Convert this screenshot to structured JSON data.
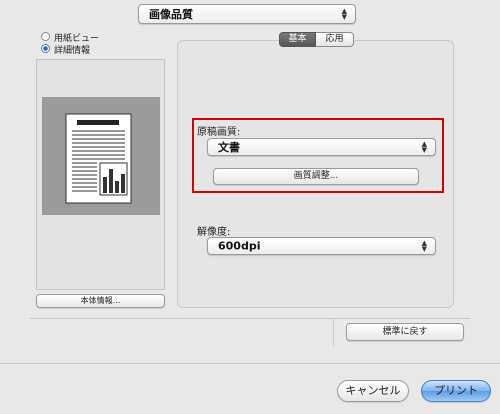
{
  "top_popup": {
    "label": "画像品質"
  },
  "view_options": {
    "paper_view": "用紙ビュー",
    "details": "詳細情報",
    "selected": "details"
  },
  "device_info_button": "本体情報...",
  "tabs": [
    {
      "label": "基本",
      "selected": true
    },
    {
      "label": "応用",
      "selected": false
    }
  ],
  "original_quality": {
    "label": "原稿画質:",
    "value": "文書",
    "adjust_button": "画質調整..."
  },
  "resolution": {
    "label": "解像度:",
    "value": "600dpi"
  },
  "restore_defaults_button": "標準に戻す",
  "cancel_button": "キャンセル",
  "print_button": "プリント",
  "highlight_color": "#d40000"
}
